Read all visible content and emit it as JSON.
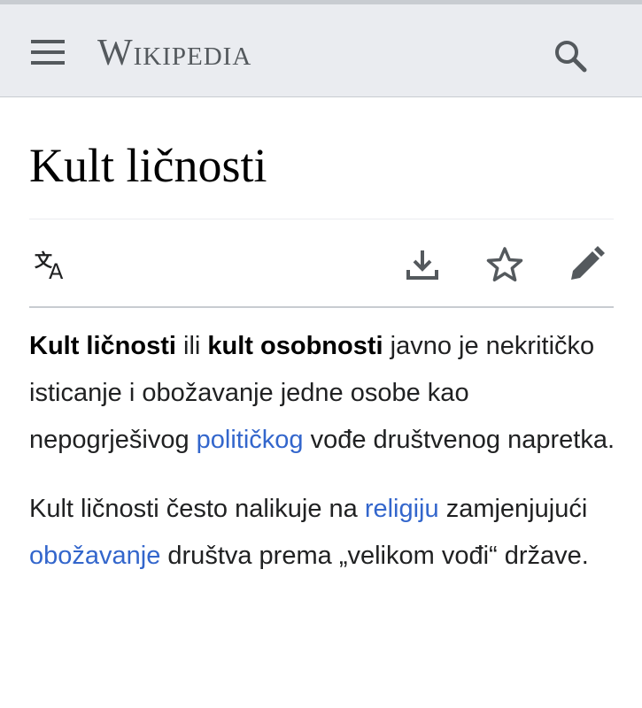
{
  "header": {
    "logo_text": "Wikipedia",
    "menu_icon": "hamburger-menu-icon",
    "search_icon": "search-icon"
  },
  "page": {
    "title": "Kult ličnosti"
  },
  "toolbar": {
    "language_icon": "language-icon",
    "download_icon": "download-icon",
    "watch_icon": "star-icon",
    "edit_icon": "pencil-icon"
  },
  "content": {
    "p1": {
      "bold1": "Kult ličnosti",
      "t1": " ili ",
      "bold2": "kult osobnosti",
      "t2": " javno je nekritičko isticanje i obožavanje jedne osobe kao nepogrješivog ",
      "link1": "političkog",
      "t3": " vođe društvenog napretka."
    },
    "p2": {
      "t1": "Kult ličnosti često nalikuje na ",
      "link1": "religiju",
      "t2": " zamjenjujući ",
      "link2": "obožavanje",
      "t3": " društva prema „velikom vođi“ države."
    }
  },
  "colors": {
    "header_bg": "#eaecf0",
    "link": "#3366cc",
    "text": "#202122",
    "icon": "#54595d"
  }
}
